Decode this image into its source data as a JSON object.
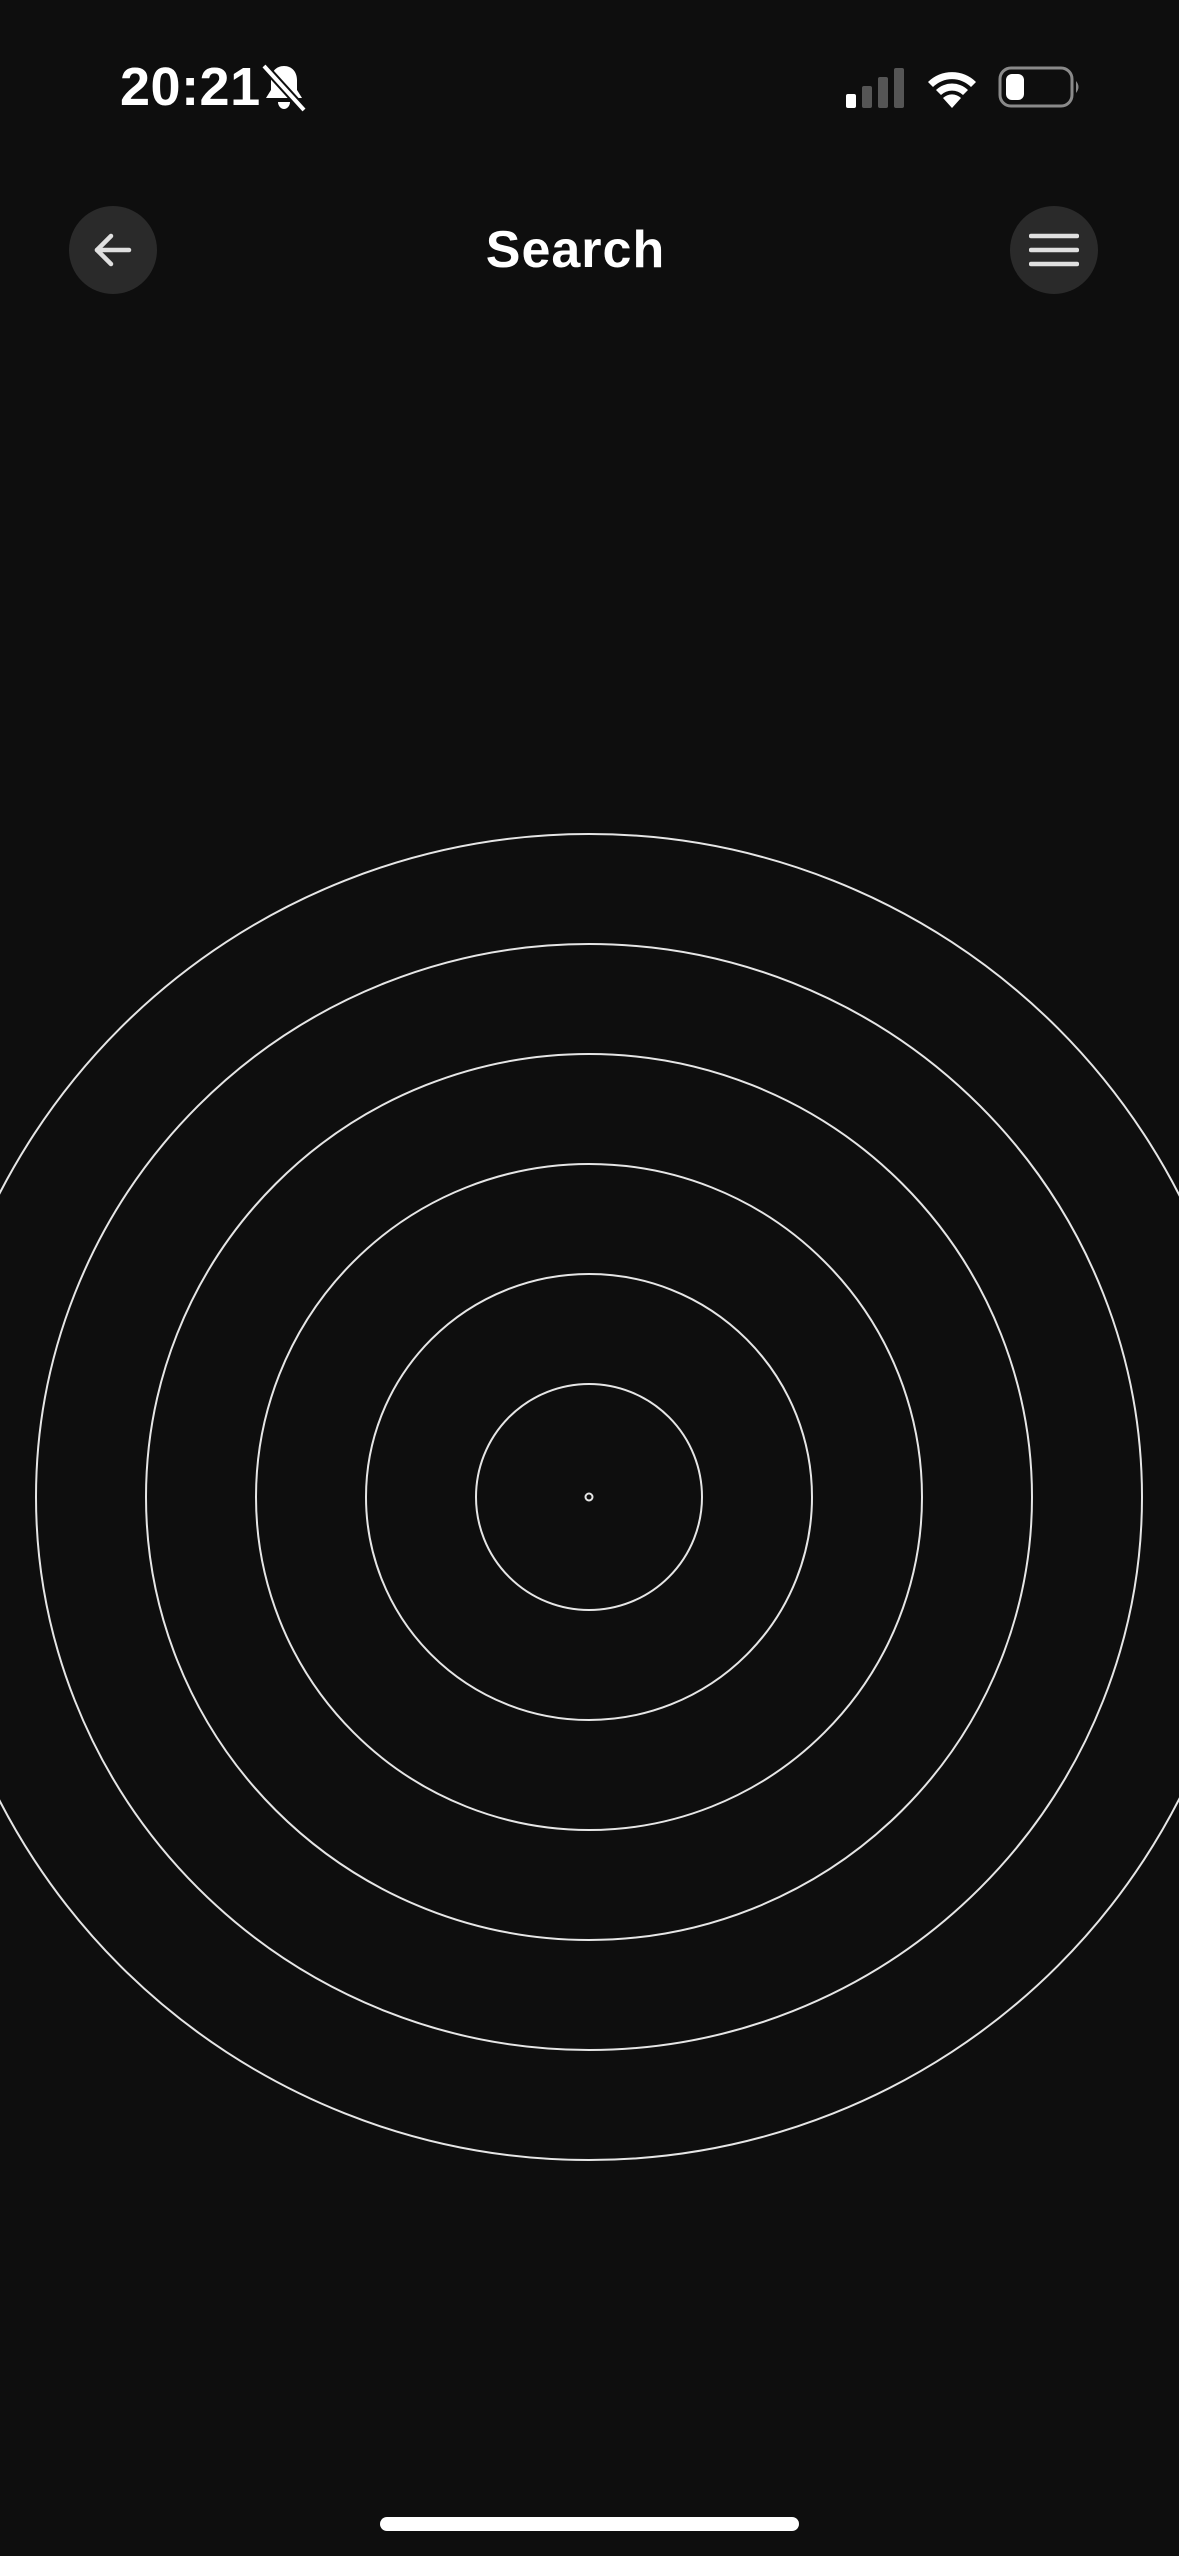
{
  "status_bar": {
    "time": "20:21",
    "icons": [
      "bell-slash-icon",
      "cellular-signal-icon",
      "wifi-icon",
      "battery-icon"
    ]
  },
  "header": {
    "title": "Search",
    "back_icon": "arrow-left-icon",
    "menu_icon": "hamburger-menu-icon"
  },
  "radar": {
    "ring_count": 6,
    "ring_color": "#e6e6e6"
  },
  "colors": {
    "background": "#0e0e0e",
    "button_background": "#2a2a2a",
    "text": "#ffffff"
  }
}
